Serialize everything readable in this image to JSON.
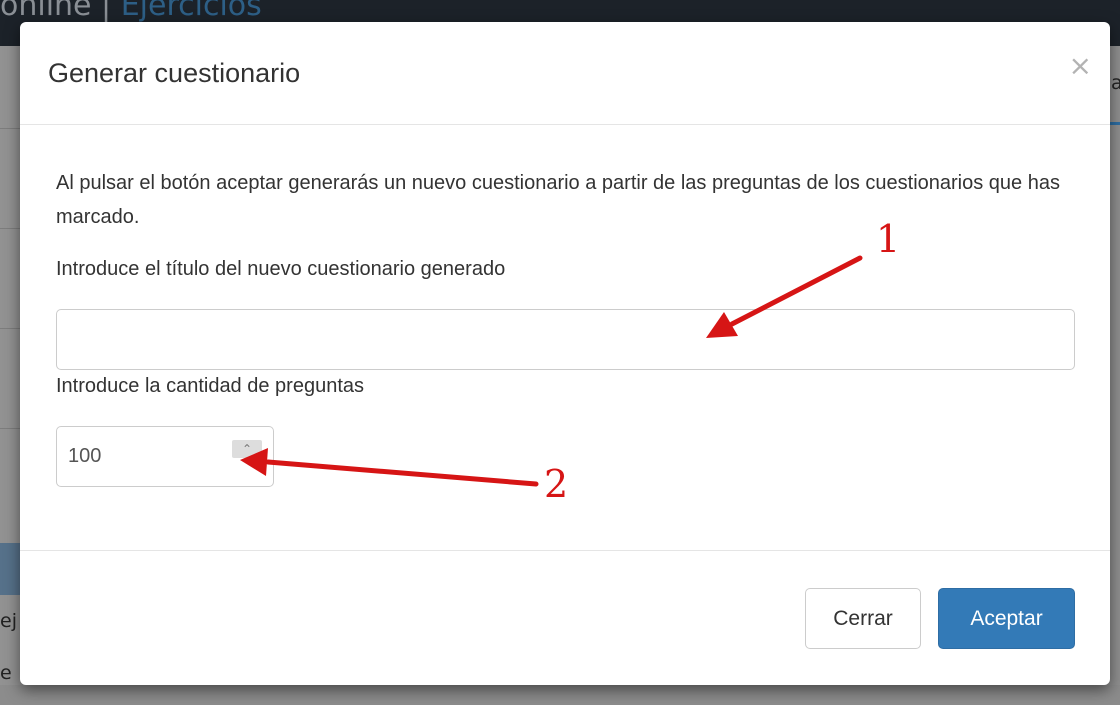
{
  "background": {
    "title_prefix": "online | ",
    "title_link": "Ejercicios",
    "left_fragments": [
      "ej",
      "e"
    ],
    "right_fragment": "a"
  },
  "modal": {
    "title": "Generar cuestionario",
    "close_glyph": "×",
    "description": "Al pulsar el botón aceptar generarás un nuevo cuestionario a partir de las preguntas de los cuestionarios que has marcado.",
    "title_field": {
      "label": "Introduce el título del nuevo cuestionario generado",
      "value": ""
    },
    "quantity_field": {
      "label": "Introduce la cantidad de preguntas",
      "value": "100",
      "spin_up_glyph": "⌃"
    },
    "buttons": {
      "close_label": "Cerrar",
      "accept_label": "Aceptar"
    }
  },
  "annotations": {
    "color": "#d61515",
    "arrow_1_label": "1",
    "arrow_2_label": "2"
  }
}
